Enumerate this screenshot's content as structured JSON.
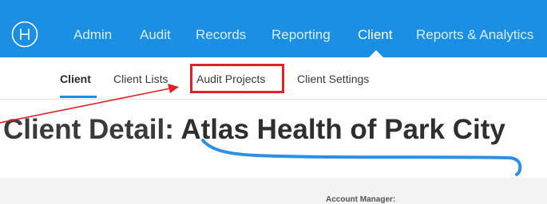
{
  "topnav": {
    "logo_icon": "plus-circle-icon",
    "items": [
      {
        "label": "Admin",
        "active": false
      },
      {
        "label": "Audit",
        "active": false
      },
      {
        "label": "Records",
        "active": false
      },
      {
        "label": "Reporting",
        "active": false
      },
      {
        "label": "Client",
        "active": true
      },
      {
        "label": "Reports & Analytics",
        "active": false
      }
    ]
  },
  "subnav": {
    "items": [
      {
        "label": "Client",
        "active": true
      },
      {
        "label": "Client Lists",
        "active": false
      },
      {
        "label": "Audit Projects",
        "active": false
      },
      {
        "label": "Client Settings",
        "active": false
      }
    ]
  },
  "page": {
    "title_prefix": "Client Detail:",
    "client_name": "Atlas Health of Park City"
  },
  "details": {
    "account_manager_label": "Account Manager:"
  },
  "colors": {
    "nav_blue": "#1a8fe3",
    "highlight_red": "#e0202a",
    "underline_blue": "#1a8fe3"
  }
}
